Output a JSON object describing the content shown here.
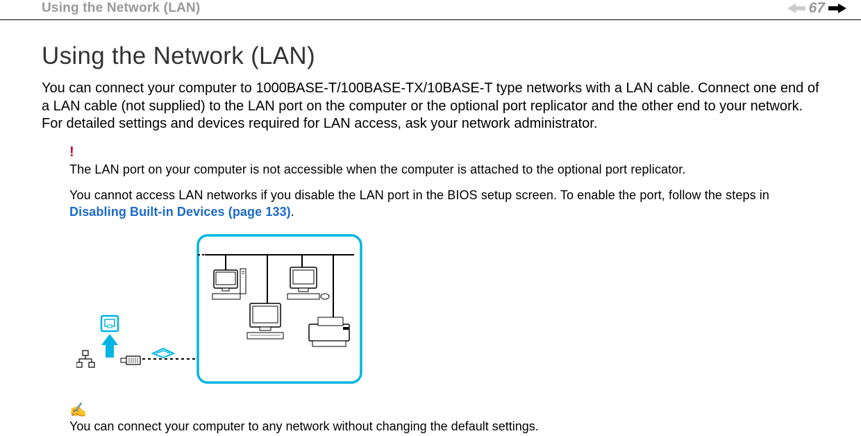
{
  "header": {
    "running_title": "Using the Network (LAN)",
    "page_number": "67"
  },
  "main": {
    "heading": "Using the Network (LAN)",
    "intro_paragraph": "You can connect your computer to 1000BASE-T/100BASE-TX/10BASE-T type networks with a LAN cable. Connect one end of a LAN cable (not supplied) to the LAN port on the computer or the optional port replicator and the other end to your network. For detailed settings and devices required for LAN access, ask your network administrator."
  },
  "warning": {
    "icon": "!",
    "line1": "The LAN port on your computer is not accessible when the computer is attached to the optional port replicator.",
    "line2_prefix": "You cannot access LAN networks if you disable the LAN port in the BIOS setup screen. To enable the port, follow the steps in ",
    "line2_link": "Disabling Built-in Devices (page 133)",
    "line2_suffix": "."
  },
  "tip": {
    "icon": "✍",
    "text": "You can connect your computer to any network without changing the default settings."
  }
}
